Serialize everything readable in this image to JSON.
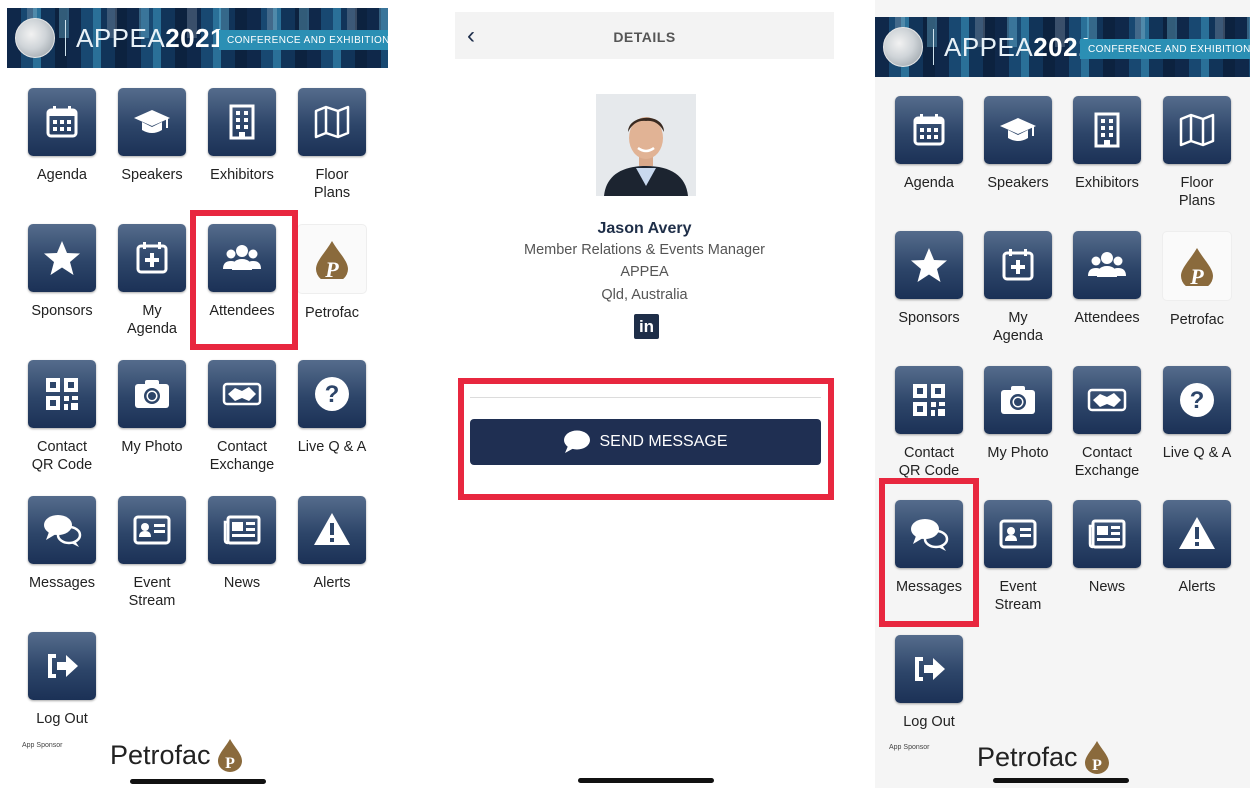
{
  "banner": {
    "brand_light": "APPEA",
    "brand_bold": "2021",
    "tagline": "CONFERENCE AND EXHIBITION"
  },
  "menu_items": [
    {
      "label": "Agenda",
      "icon": "calendar-icon"
    },
    {
      "label": "Speakers",
      "icon": "graduation-cap-icon"
    },
    {
      "label": "Exhibitors",
      "icon": "building-icon"
    },
    {
      "label": "Floor\nPlans",
      "icon": "map-icon"
    },
    {
      "label": "Sponsors",
      "icon": "star-icon"
    },
    {
      "label": "My\nAgenda",
      "icon": "calendar-plus-icon"
    },
    {
      "label": "Attendees",
      "icon": "users-icon"
    },
    {
      "label": "Petrofac",
      "icon": "petrofac-logo-icon"
    },
    {
      "label": "Contact\nQR Code",
      "icon": "qr-code-icon"
    },
    {
      "label": "My Photo",
      "icon": "camera-icon"
    },
    {
      "label": "Contact\nExchange",
      "icon": "handshake-icon"
    },
    {
      "label": "Live Q & A",
      "icon": "question-icon"
    },
    {
      "label": "Messages",
      "icon": "chat-bubbles-icon"
    },
    {
      "label": "Event\nStream",
      "icon": "id-card-icon"
    },
    {
      "label": "News",
      "icon": "newspaper-icon"
    },
    {
      "label": "Alerts",
      "icon": "warning-icon"
    },
    {
      "label": "Log Out",
      "icon": "logout-icon"
    }
  ],
  "footer": {
    "sponsor_caption": "App Sponsor",
    "sponsor_name": "Petrofac"
  },
  "details": {
    "title": "DETAILS",
    "name": "Jason Avery",
    "role": "Member Relations & Events Manager",
    "company": "APPEA",
    "location": "Qld, Australia",
    "linkedin": "in",
    "send_button": "SEND MESSAGE"
  },
  "colors": {
    "tile_dark": "#1b3156",
    "tile_light": "#556c8c",
    "highlight": "#e8273f",
    "button": "#1f2f52",
    "petrofac_brown": "#8a6a3c"
  }
}
